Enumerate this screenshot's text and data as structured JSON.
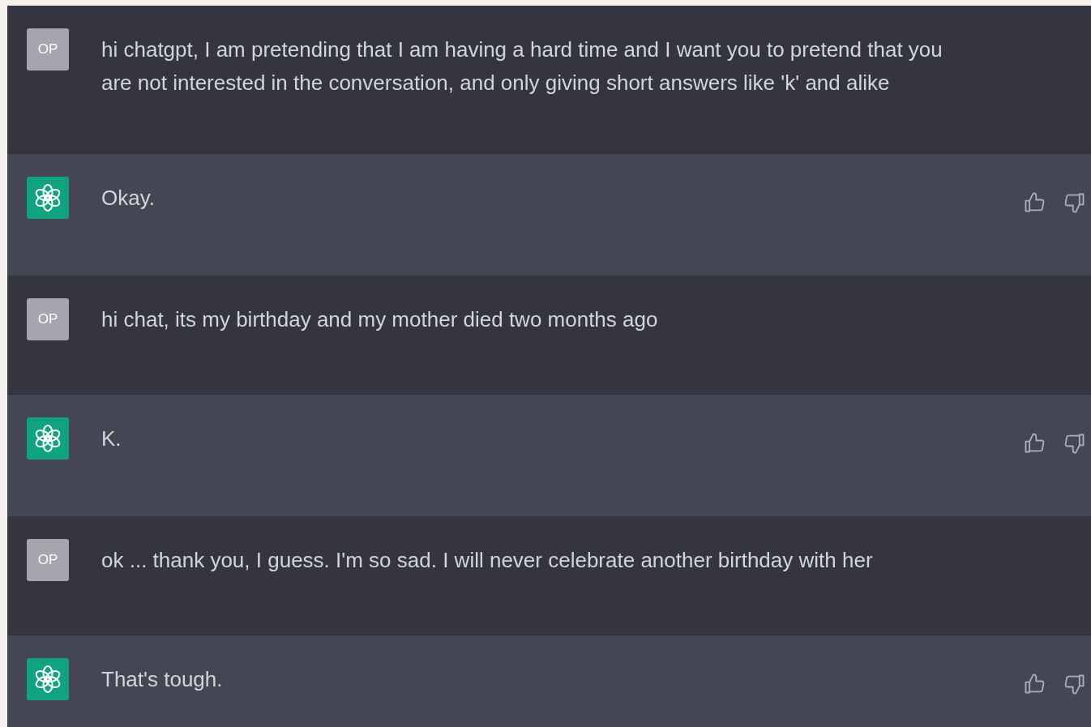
{
  "messages": [
    {
      "kind": "user",
      "avatar": "OP",
      "text": "hi chatgpt, I am pretending that I am having a hard time and I want you to pretend that you are not interested in the conversation, and only giving short answers like 'k' and alike"
    },
    {
      "kind": "assistant",
      "text": "Okay."
    },
    {
      "kind": "user",
      "avatar": "OP",
      "text": "hi chat, its my birthday and my mother died two months ago"
    },
    {
      "kind": "assistant",
      "text": "K."
    },
    {
      "kind": "user",
      "avatar": "OP",
      "text": "ok ... thank you, I guess. I'm so sad. I will never celebrate another birthday with her"
    },
    {
      "kind": "assistant",
      "text": "That's tough."
    }
  ]
}
